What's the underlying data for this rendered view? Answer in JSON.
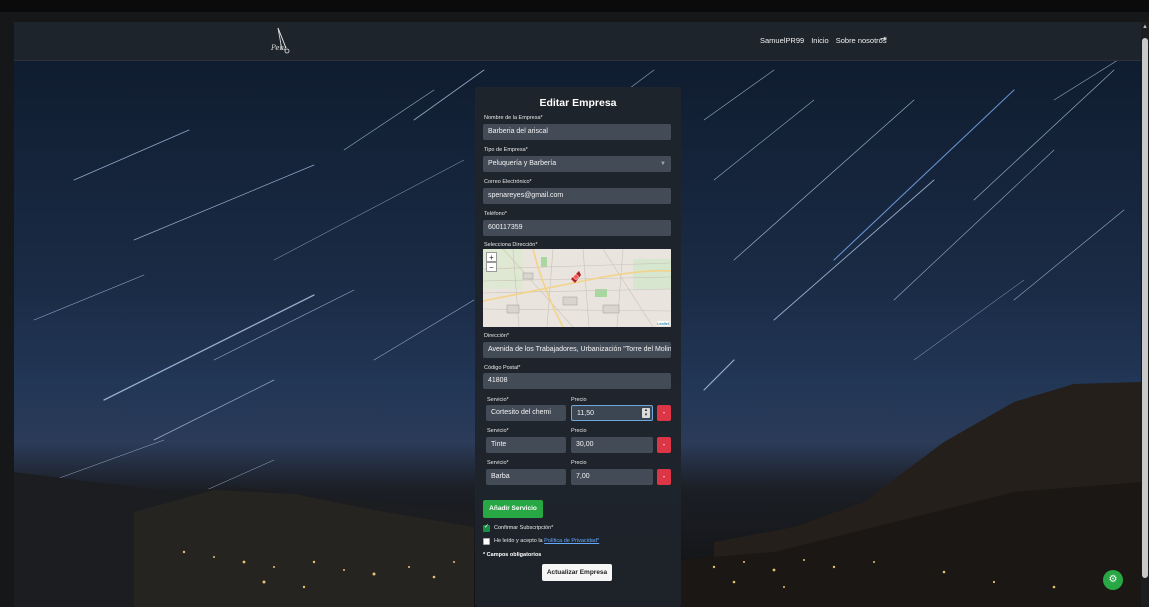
{
  "navbar": {
    "logo_text": "Pelu",
    "username": "SamuelPR99",
    "home": "Inicio",
    "about": "Sobre nosotros",
    "logout_icon": "logout-icon"
  },
  "form": {
    "title": "Editar Empresa",
    "name_label": "Nombre de la Empresa*",
    "name_value": "Barberia del ariscal",
    "type_label": "Tipo de Empresa*",
    "type_value": "Peluquería y Barbería",
    "email_label": "Correo Electrónico*",
    "email_value": "spenareyes@gmail.com",
    "phone_label": "Teléfono*",
    "phone_value": "600117359",
    "map_label": "Selecciona Dirección*",
    "map": {
      "zoom_in": "+",
      "zoom_out": "−",
      "attribution": "Leaflet"
    },
    "address_label": "Dirección*",
    "address_value": "Avenida de los Trabajadores, Urbanización \"Torre del Molino\", V",
    "postal_label": "Código Postal*",
    "postal_value": "41808",
    "services": [
      {
        "service_label": "Servicio*",
        "price_label": "Precio",
        "service": "Cortesito del chemi",
        "price": "11,50"
      },
      {
        "service_label": "Servicio*",
        "price_label": "Precio",
        "service": "Tinte",
        "price": "30,00"
      },
      {
        "service_label": "Servicio*",
        "price_label": "Precio",
        "service": "Barba",
        "price": "7,00"
      }
    ],
    "delete_label": "-",
    "add_service": "Añadir Servicio",
    "confirm_subscription": "Confirmar Subscripción*",
    "privacy_prefix": "He leído y acepto la",
    "privacy_link": "Política de Privacidad*",
    "required_note": "* Campos obligatorios",
    "submit": "Actualizar Empresa"
  },
  "colors": {
    "accent_green": "#28a745",
    "danger_red": "#dc3545",
    "panel_bg": "#1f242b",
    "input_bg": "#434b57"
  }
}
